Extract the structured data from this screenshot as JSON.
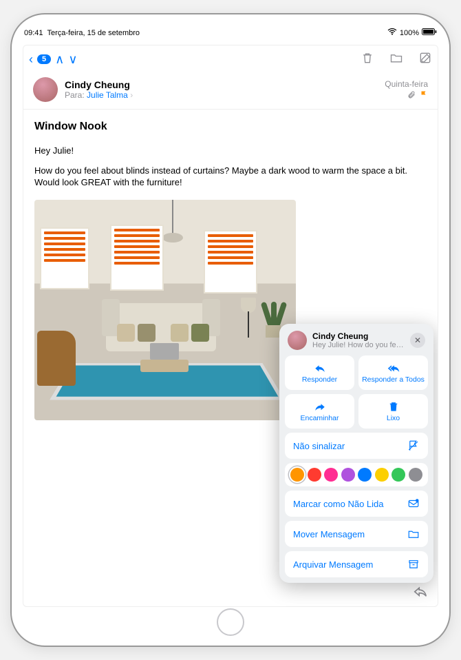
{
  "statusbar": {
    "time": "09:41",
    "date": "Terça-feira, 15 de setembro",
    "battery_pct": "100%"
  },
  "toolbar": {
    "unread_count": "5"
  },
  "message": {
    "from_name": "Cindy Cheung",
    "to_label": "Para:",
    "to_recipient": "Julie Talma",
    "date": "Quinta-feira",
    "subject": "Window Nook",
    "greeting": "Hey Julie!",
    "body": "How do you feel about blinds instead of curtains? Maybe a dark wood to warm the space a bit. Would look GREAT with the furniture!"
  },
  "popover": {
    "name": "Cindy Cheung",
    "preview": "Hey Julie! How do you feel ab…",
    "reply": "Responder",
    "reply_all": "Responder a Todos",
    "forward": "Encaminhar",
    "trash": "Lixo",
    "unflag": "Não sinalizar",
    "mark_unread": "Marcar como Não Lida",
    "move": "Mover Mensagem",
    "archive": "Arquivar Mensagem",
    "flag_colors": [
      "#ff9500",
      "#ff3b30",
      "#ff2d92",
      "#af52de",
      "#007aff",
      "#fccf00",
      "#34c759",
      "#8e8e93"
    ]
  }
}
